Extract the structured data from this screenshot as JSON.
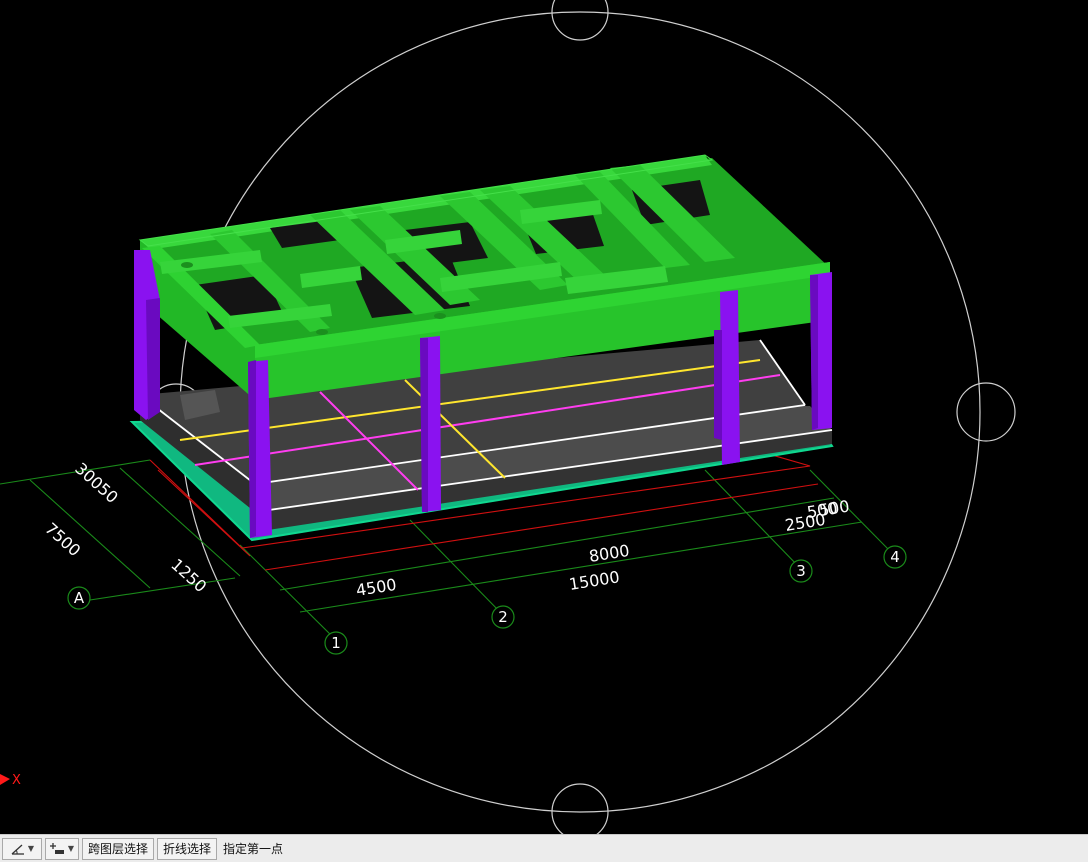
{
  "viewport": {
    "axis_label": "X",
    "grid_axes": [
      "1",
      "2",
      "3",
      "4",
      "A"
    ],
    "dimensions": {
      "d4500": "4500",
      "d8000": "8000",
      "d2500": "2500",
      "d15000": "15000",
      "d500": "500",
      "d7500": "7500",
      "d1250": "1250",
      "d_overlap": "30050"
    },
    "colors": {
      "beam": "#27c42b",
      "column": "#8a12f0",
      "slab": "#3e3e3e",
      "grid_line": "#1a8a1a",
      "dim_red": "#d01010",
      "line_yellow": "#ffe62e",
      "line_magenta": "#ff3df0",
      "foundation": "#10d890"
    },
    "icons": [
      "orbit-circle-icon",
      "ucs-axis-icon"
    ]
  },
  "statusbar": {
    "tool1_icon": "angle-snap-icon",
    "tool2_icon": "layer-add-icon",
    "cross_layer_select": "跨图层选择",
    "polyline_select": "折线选择",
    "prompt": "指定第一点"
  }
}
